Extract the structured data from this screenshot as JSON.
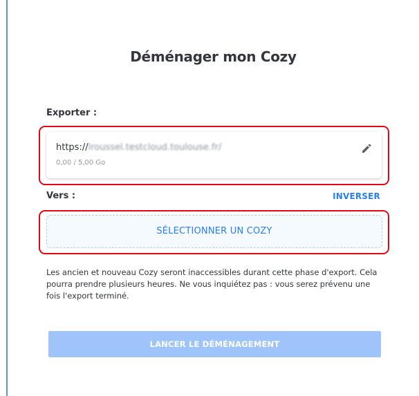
{
  "dialog": {
    "title": "Déménager mon Cozy"
  },
  "source": {
    "label": "Exporter :",
    "url_prefix": "https://",
    "url_blurred": "lroussel.testcloud.toulouse.fr/",
    "usage": "0,00 / 5,00 Go",
    "edit_icon": "pencil-icon"
  },
  "target": {
    "label": "Vers :",
    "swap_label": "Inverser",
    "select_label": "Sélectionner un Cozy"
  },
  "info": {
    "text": "Les ancien et nouveau Cozy seront inaccessibles durant cette phase d'export. Cela pourra prendre plusieurs heures. Ne vous inquiétez pas : vous serez prévenu une fois l'export terminé."
  },
  "actions": {
    "launch_label": "Lancer le déménagement",
    "launch_enabled": false
  },
  "colors": {
    "accent": "#297ef2",
    "highlight": "#e30613",
    "disabled_button": "#9fc4fb",
    "text": "#32363f",
    "muted": "#95999d",
    "window_edge": "#5f8fd1"
  }
}
